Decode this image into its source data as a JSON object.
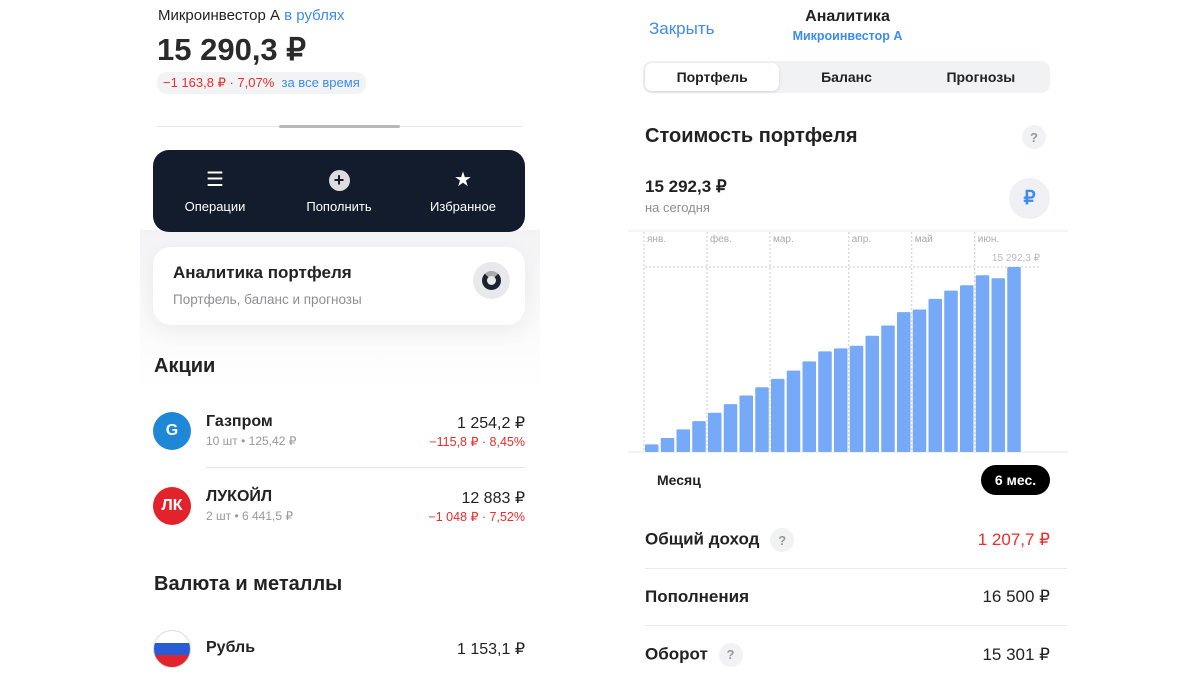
{
  "left": {
    "account": "Микроинвестор А",
    "currency_link": "в рублях",
    "total": "15 290,3 ₽",
    "change": "−1 163,8 ₽ · 7,07%",
    "change_period": "за все время",
    "toolbar": [
      {
        "label": "Операции",
        "icon": "operations-icon"
      },
      {
        "label": "Пополнить",
        "icon": "plus-circle-icon"
      },
      {
        "label": "Избранное",
        "icon": "star-icon"
      }
    ],
    "analytics_card": {
      "title": "Аналитика портфеля",
      "subtitle": "Портфель, баланс и прогнозы"
    },
    "stocks_title": "Акции",
    "stocks": [
      {
        "name": "Газпром",
        "sub": "10 шт • 125,42 ₽",
        "value": "1 254,2 ₽",
        "change": "−115,8 ₽ · 8,45%",
        "color": "#1e88d6"
      },
      {
        "name": "ЛУКОЙЛ",
        "sub": "2 шт • 6 441,5 ₽",
        "value": "12 883 ₽",
        "change": "−1 048 ₽ · 7,52%",
        "color": "#e3232b"
      }
    ],
    "currency_title": "Валюта и металлы",
    "currencies": [
      {
        "name": "Рубль",
        "value": "1 153,1 ₽"
      }
    ]
  },
  "right": {
    "close": "Закрыть",
    "title": "Аналитика",
    "subtitle": "Микроинвестор А",
    "tabs": [
      "Портфель",
      "Баланс",
      "Прогнозы"
    ],
    "active_tab": 0,
    "section_title": "Стоимость портфеля",
    "help": "?",
    "value": "15 292,3 ₽",
    "value_caption": "на сегодня",
    "currency_button": "₽",
    "periods": [
      "Месяц",
      "6 мес."
    ],
    "active_period": 1,
    "stats": [
      {
        "label": "Общий доход",
        "value": "1 207,7 ₽",
        "help": true,
        "color": "#ef2b2b"
      },
      {
        "label": "Пополнения",
        "value": "16 500 ₽",
        "help": false
      },
      {
        "label": "Оборот",
        "value": "15 301 ₽",
        "help": true
      }
    ]
  },
  "chart_data": {
    "type": "bar",
    "title": "Стоимость портфеля",
    "bar_color": "#76a9f7",
    "months": [
      "янв.",
      "фев.",
      "мар.",
      "апр.",
      "май",
      "июн."
    ],
    "month_start_bar": [
      0,
      4,
      8,
      13,
      17,
      21
    ],
    "max_label": "15 292,3 ₽",
    "values": [
      631,
      1153,
      1867,
      2553,
      3240,
      3953,
      4667,
      5354,
      6040,
      6726,
      7495,
      8319,
      8566,
      8785,
      9609,
      10460,
      11558,
      11778,
      12657,
      13343,
      13782,
      14606,
      14359,
      15292.3
    ],
    "ylim": [
      0,
      15292.3
    ]
  }
}
